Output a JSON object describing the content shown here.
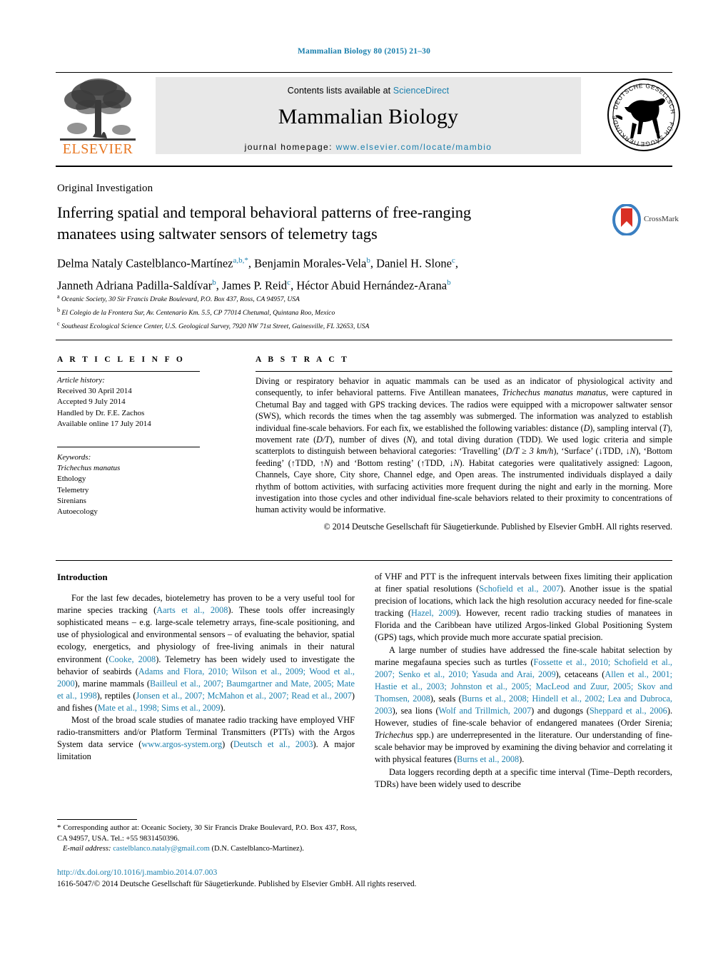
{
  "running_head": "Mammalian Biology 80 (2015) 21–30",
  "masthead": {
    "contents_prefix": "Contents lists available at ",
    "sciencedirect": "ScienceDirect",
    "journal_title": "Mammalian Biology",
    "homepage_label": "journal homepage:",
    "homepage_url": "www.elsevier.com/locate/mambio",
    "publisher_wordmark": "ELSEVIER",
    "society_logo_text": "DEUTSCHE GESELLSCHAFT FÜR SÄUGETIERKUNDE"
  },
  "article": {
    "kicker": "Original Investigation",
    "title_line1": "Inferring spatial and temporal behavioral patterns of free-ranging",
    "title_line2": "manatees using saltwater sensors of telemetry tags",
    "crossmark_label": "CrossMark"
  },
  "authors": {
    "line1_a": "Delma Nataly Castelblanco-Martínez",
    "line1_a_sup": "a,b,",
    "line1_a_star": "*",
    "line1_b": ", Benjamin Morales-Vela",
    "line1_b_sup": "b",
    "line1_c": ", Daniel H. Slone",
    "line1_c_sup": "c",
    "line1_end": ",",
    "line2_a": "Janneth Adriana Padilla-Saldívar",
    "line2_a_sup": "b",
    "line2_b": ", James P. Reid",
    "line2_b_sup": "c",
    "line2_c": ", Héctor Abuid Hernández-Arana",
    "line2_c_sup": "b"
  },
  "affiliations": [
    {
      "marker": "a",
      "text": "Oceanic Society, 30 Sir Francis Drake Boulevard, P.O. Box 437, Ross, CA 94957, USA"
    },
    {
      "marker": "b",
      "text": "El Colegio de la Frontera Sur, Av. Centenario Km. 5.5, CP 77014 Chetumal, Quintana Roo, Mexico"
    },
    {
      "marker": "c",
      "text": "Southeast Ecological Science Center, U.S. Geological Survey, 7920 NW 71st Street, Gainesville, FL 32653, USA"
    }
  ],
  "article_info": {
    "heading": "A R T I C L E   I N F O",
    "history_label": "Article history:",
    "history": [
      "Received 30 April 2014",
      "Accepted 9 July 2014",
      "Handled by Dr. F.E. Zachos",
      "Available online 17 July 2014"
    ],
    "keywords_label": "Keywords:",
    "keywords": [
      "Trichechus manatus",
      "Ethology",
      "Telemetry",
      "Sirenians",
      "Autoecology"
    ],
    "keyword_italic_index": 0
  },
  "abstract": {
    "heading": "A B S T R A C T",
    "part1": "Diving or respiratory behavior in aquatic mammals can be used as an indicator of physiological activity and consequently, to infer behavioral patterns. Five Antillean manatees, ",
    "species": "Trichechus manatus manatus",
    "part2": ", were captured in Chetumal Bay and tagged with GPS tracking devices. The radios were equipped with a micropower saltwater sensor (SWS), which records the times when the tag assembly was submerged. The information was analyzed to establish individual fine-scale behaviors. For each fix, we established the following variables: distance (",
    "var_d": "D",
    "part3": "), sampling interval (",
    "var_t": "T",
    "part4": "), movement rate (",
    "var_dt": "D/T",
    "part5": "), number of dives (",
    "var_n": "N",
    "part6": "), and total diving duration (TDD). We used logic criteria and simple scatterplots to distinguish between behavioral categories: ‘Travelling’ (",
    "crit_travel": "D/T ≥ 3 km/h",
    "part7": "), ‘Surface’ (↓TDD, ↓",
    "var_n2": "N",
    "part8": "), ‘Bottom feeding’ (↑TDD, ↑",
    "var_n3": "N",
    "part9": ") and ‘Bottom resting’ (↑TDD, ↓",
    "var_n4": "N",
    "part10": "). Habitat categories were qualitatively assigned: Lagoon, Channels, Caye shore, City shore, Channel edge, and Open areas. The instrumented individuals displayed a daily rhythm of bottom activities, with surfacing activities more frequent during the night and early in the morning. More investigation into those cycles and other individual fine-scale behaviors related to their proximity to concentrations of human activity would be informative.",
    "copyright": "© 2014 Deutsche Gesellschaft für Säugetierkunde. Published by Elsevier GmbH. All rights reserved."
  },
  "introduction": {
    "heading": "Introduction",
    "left_p1_a": "For the last few decades, biotelemetry has proven to be a very useful tool for marine species tracking (",
    "left_p1_c1": "Aarts et al., 2008",
    "left_p1_b": "). These tools offer increasingly sophisticated means – e.g. large-scale telemetry arrays, fine-scale positioning, and use of physiological and environmental sensors – of evaluating the behavior, spatial ecology, energetics, and physiology of free-living animals in their natural environment (",
    "left_p1_c2": "Cooke, 2008",
    "left_p1_d": "). Telemetry has been widely used to investigate the behavior of seabirds (",
    "left_p1_c3": "Adams and Flora, 2010; Wilson et al., 2009; Wood et al., 2000",
    "left_p1_e": "), marine mammals (",
    "left_p1_c4": "Bailleul et al., 2007; Baumgartner and Mate, 2005; Mate et al., 1998",
    "left_p1_f": "), reptiles (",
    "left_p1_c5": "Jonsen et al., 2007; McMahon et al., 2007; Read et al., 2007",
    "left_p1_g": ") and fishes (",
    "left_p1_c6": "Mate et al., 1998; Sims et al., 2009",
    "left_p1_h": ").",
    "left_p2_a": "Most of the broad scale studies of manatee radio tracking have employed VHF radio-transmitters and/or Platform Terminal Transmitters (PTTs) with the Argos System data service (",
    "left_p2_url": "www.argos-system.org",
    "left_p2_b": ") (",
    "left_p2_c1": "Deutsch et al., 2003",
    "left_p2_c": "). A major limitation",
    "right_p1_a": "of VHF and PTT is the infrequent intervals between fixes limiting their application at finer spatial resolutions (",
    "right_p1_c1": "Schofield et al., 2007",
    "right_p1_b": "). Another issue is the spatial precision of locations, which lack the high resolution accuracy needed for fine-scale tracking (",
    "right_p1_c2": "Hazel, 2009",
    "right_p1_c": "). However, recent radio tracking studies of manatees in Florida and the Caribbean have utilized Argos-linked Global Positioning System (GPS) tags, which provide much more accurate spatial precision.",
    "right_p2_a": "A large number of studies have addressed the fine-scale habitat selection by marine megafauna species such as turtles (",
    "right_p2_c1": "Fossette et al., 2010; Schofield et al., 2007; Senko et al., 2010; Yasuda and Arai, 2009",
    "right_p2_b": "), cetaceans (",
    "right_p2_c2": "Allen et al., 2001; Hastie et al., 2003; Johnston et al., 2005; MacLeod and Zuur, 2005; Skov and Thomsen, 2008",
    "right_p2_c": "), seals (",
    "right_p2_c3": "Burns et al., 2008; Hindell et al., 2002; Lea and Dubroca, 2003",
    "right_p2_d": "), sea lions (",
    "right_p2_c4": "Wolf and Trillmich, 2007",
    "right_p2_e": ") and dugongs (",
    "right_p2_c5": "Sheppard et al., 2006",
    "right_p2_f": "). However, studies of fine-scale behavior of endangered manatees (Order Sirenia; ",
    "right_p2_genus": "Trichechus",
    "right_p2_g": " spp.) are underrepresented in the literature. Our understanding of fine-scale behavior may be improved by examining the diving behavior and correlating it with physical features (",
    "right_p2_c6": "Burns et al., 2008",
    "right_p2_h": ").",
    "right_p3": "Data loggers recording depth at a specific time interval (Time–Depth recorders, TDRs) have been widely used to describe"
  },
  "footer": {
    "corresponding_star": "*",
    "corresponding_text": " Corresponding author at: Oceanic Society, 30 Sir Francis Drake Boulevard, P.O. Box 437, Ross, CA 94957, USA. Tel.: +55 9831450396.",
    "email_label": "E-mail address:",
    "email": "castelblanco.nataly@gmail.com",
    "email_suffix": " (D.N. Castelblanco-Martinez).",
    "doi": "http://dx.doi.org/10.1016/j.mambio.2014.07.003",
    "issn_line": "1616-5047/© 2014 Deutsche Gesellschaft für Säugetierkunde. Published by Elsevier GmbH. All rights reserved."
  },
  "colors": {
    "link": "#1a7fad",
    "elsevier_orange": "#E87722",
    "banner_bg": "#e8e8e8",
    "crossmark_red": "#d93025",
    "crossmark_blue": "#3a7fc1"
  }
}
